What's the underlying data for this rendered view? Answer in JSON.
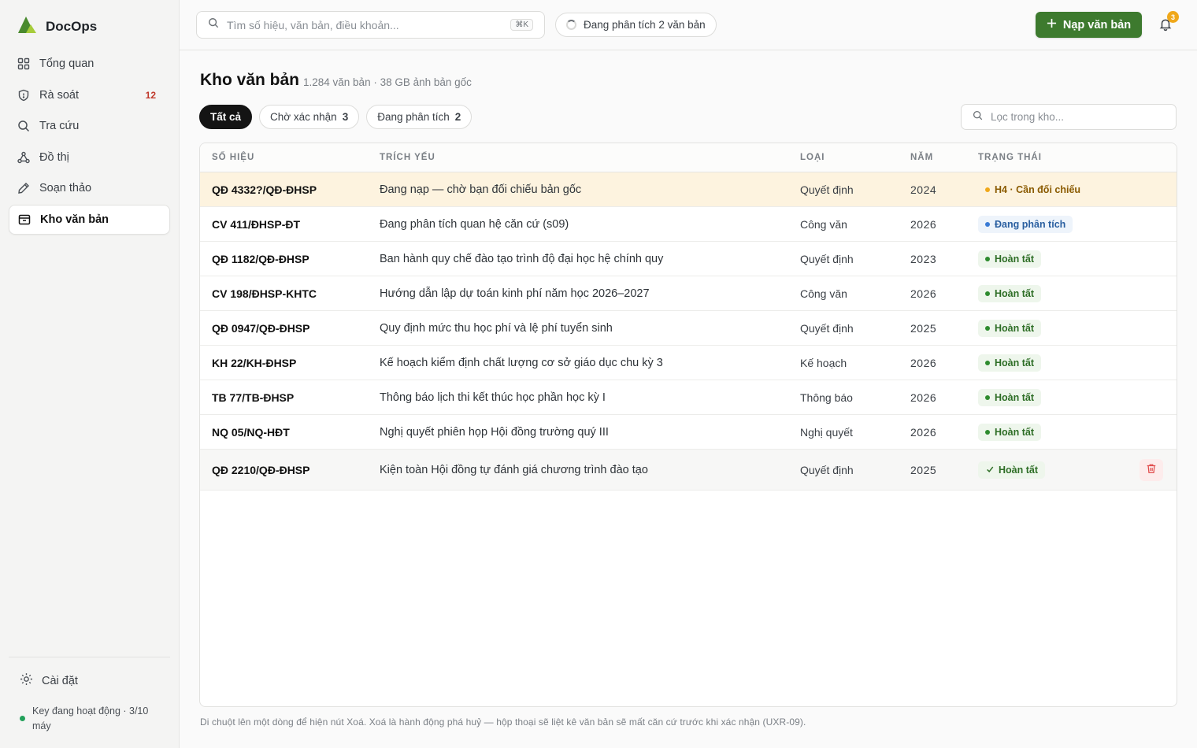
{
  "app": {
    "name": "DocOps"
  },
  "sidebar": {
    "items": [
      {
        "label": "Tổng quan",
        "icon": "dashboard-icon"
      },
      {
        "label": "Rà soát",
        "icon": "shield-icon",
        "badge": "12"
      },
      {
        "label": "Tra cứu",
        "icon": "search-icon"
      },
      {
        "label": "Đồ thị",
        "icon": "graph-icon"
      },
      {
        "label": "Soạn thảo",
        "icon": "pencil-icon"
      },
      {
        "label": "Kho văn bản",
        "icon": "archive-icon",
        "active": true
      }
    ],
    "settings_label": "Cài đặt",
    "key_status": "Key đang hoạt động · 3/10 máy"
  },
  "topbar": {
    "search_placeholder": "Tìm số hiệu, văn bản, điều khoản...",
    "search_shortcut": "⌘K",
    "analyzing_label": "Đang phân tích 2 văn bản",
    "upload_label": "Nạp văn bản",
    "notification_count": "3"
  },
  "page": {
    "title": "Kho văn bản",
    "meta": "1.284 văn bản · 38 GB ảnh bản gốc",
    "filter_placeholder": "Lọc trong kho...",
    "footnote": "Di chuột lên một dòng để hiện nút Xoá. Xoá là hành động phá huỷ — hộp thoại sẽ liệt kê văn bản sẽ mất căn cứ trước khi xác nhận (UXR-09)."
  },
  "tabs": [
    {
      "label": "Tất cả",
      "count": ""
    },
    {
      "label": "Chờ xác nhận",
      "count": "3"
    },
    {
      "label": "Đang phân tích",
      "count": "2"
    }
  ],
  "table": {
    "headers": [
      "Số hiệu",
      "Trích yếu",
      "Loại",
      "Năm",
      "Trạng thái"
    ],
    "rows": [
      {
        "code": "QĐ 4332?/QĐ-ĐHSP",
        "summary": "Đang nạp — chờ bạn đối chiếu bản gốc",
        "type": "Quyết định",
        "year": "2024",
        "status": "H4 · Cần đối chiếu",
        "status_kind": "warn"
      },
      {
        "code": "CV 411/ĐHSP-ĐT",
        "summary": "Đang phân tích quan hệ căn cứ (s09)",
        "type": "Công văn",
        "year": "2026",
        "status": "Đang phân tích",
        "status_kind": "info"
      },
      {
        "code": "QĐ 1182/QĐ-ĐHSP",
        "summary": "Ban hành quy chế đào tạo trình độ đại học hệ chính quy",
        "type": "Quyết định",
        "year": "2023",
        "status": "Hoàn tất",
        "status_kind": "done"
      },
      {
        "code": "CV 198/ĐHSP-KHTC",
        "summary": "Hướng dẫn lập dự toán kinh phí năm học 2026–2027",
        "type": "Công văn",
        "year": "2026",
        "status": "Hoàn tất",
        "status_kind": "done"
      },
      {
        "code": "QĐ 0947/QĐ-ĐHSP",
        "summary": "Quy định mức thu học phí và lệ phí tuyển sinh",
        "type": "Quyết định",
        "year": "2025",
        "status": "Hoàn tất",
        "status_kind": "done"
      },
      {
        "code": "KH 22/KH-ĐHSP",
        "summary": "Kế hoạch kiểm định chất lượng cơ sở giáo dục chu kỳ 3",
        "type": "Kế hoạch",
        "year": "2026",
        "status": "Hoàn tất",
        "status_kind": "done"
      },
      {
        "code": "TB 77/TB-ĐHSP",
        "summary": "Thông báo lịch thi kết thúc học phần học kỳ I",
        "type": "Thông báo",
        "year": "2026",
        "status": "Hoàn tất",
        "status_kind": "done"
      },
      {
        "code": "NQ 05/NQ-HĐT",
        "summary": "Nghị quyết phiên họp Hội đồng trường quý III",
        "type": "Nghị quyết",
        "year": "2026",
        "status": "Hoàn tất",
        "status_kind": "done"
      },
      {
        "code": "QĐ 2210/QĐ-ĐHSP",
        "summary": "Kiện toàn Hội đồng tự đánh giá chương trình đào tạo",
        "type": "Quyết định",
        "year": "2025",
        "status": "Hoàn tất",
        "status_kind": "check"
      }
    ]
  },
  "colors": {
    "accent": "#3d7a2e",
    "warn": "#f0a81a",
    "danger": "#e04848",
    "info": "#3a7bd5"
  }
}
